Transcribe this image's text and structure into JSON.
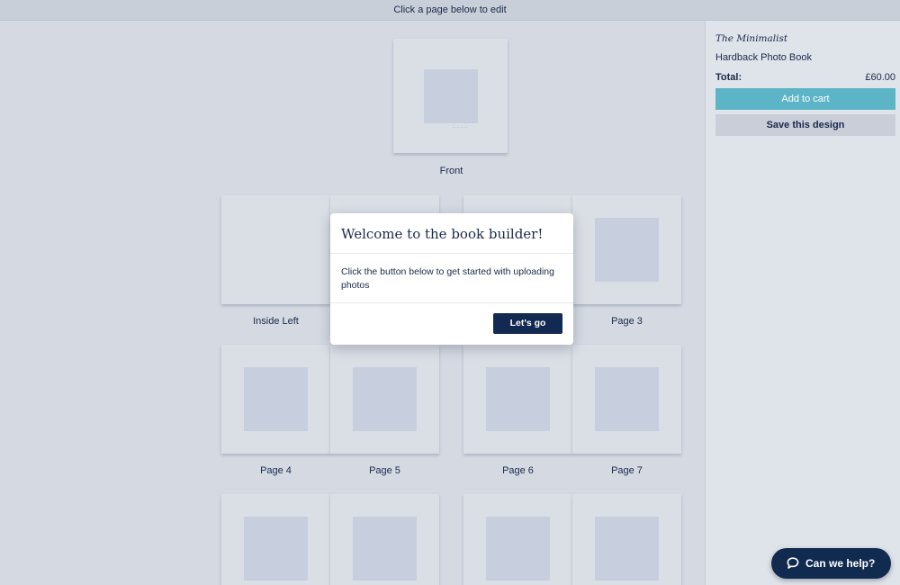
{
  "topbar": {
    "instruction": "Click a page below to edit"
  },
  "sidebar": {
    "book_title": "The Minimalist",
    "book_type": "Hardback Photo Book",
    "total_label": "Total:",
    "total_value": "£60.00",
    "add_to_cart": "Add to cart",
    "save_design": "Save this design"
  },
  "pages": {
    "front": "Front",
    "inside_left": "Inside Left",
    "page3": "Page 3",
    "page4": "Page 4",
    "page5": "Page 5",
    "page6": "Page 6",
    "page7": "Page 7"
  },
  "modal": {
    "title": "Welcome to the book builder!",
    "body": "Click the button below to get started with uploading photos",
    "button": "Let's go"
  },
  "help": {
    "label": "Can we help?",
    "icon": "chat-bubble-icon"
  },
  "colors": {
    "accent": "#5cb4c7",
    "primary": "#122a52",
    "background": "#d4d9e2"
  }
}
